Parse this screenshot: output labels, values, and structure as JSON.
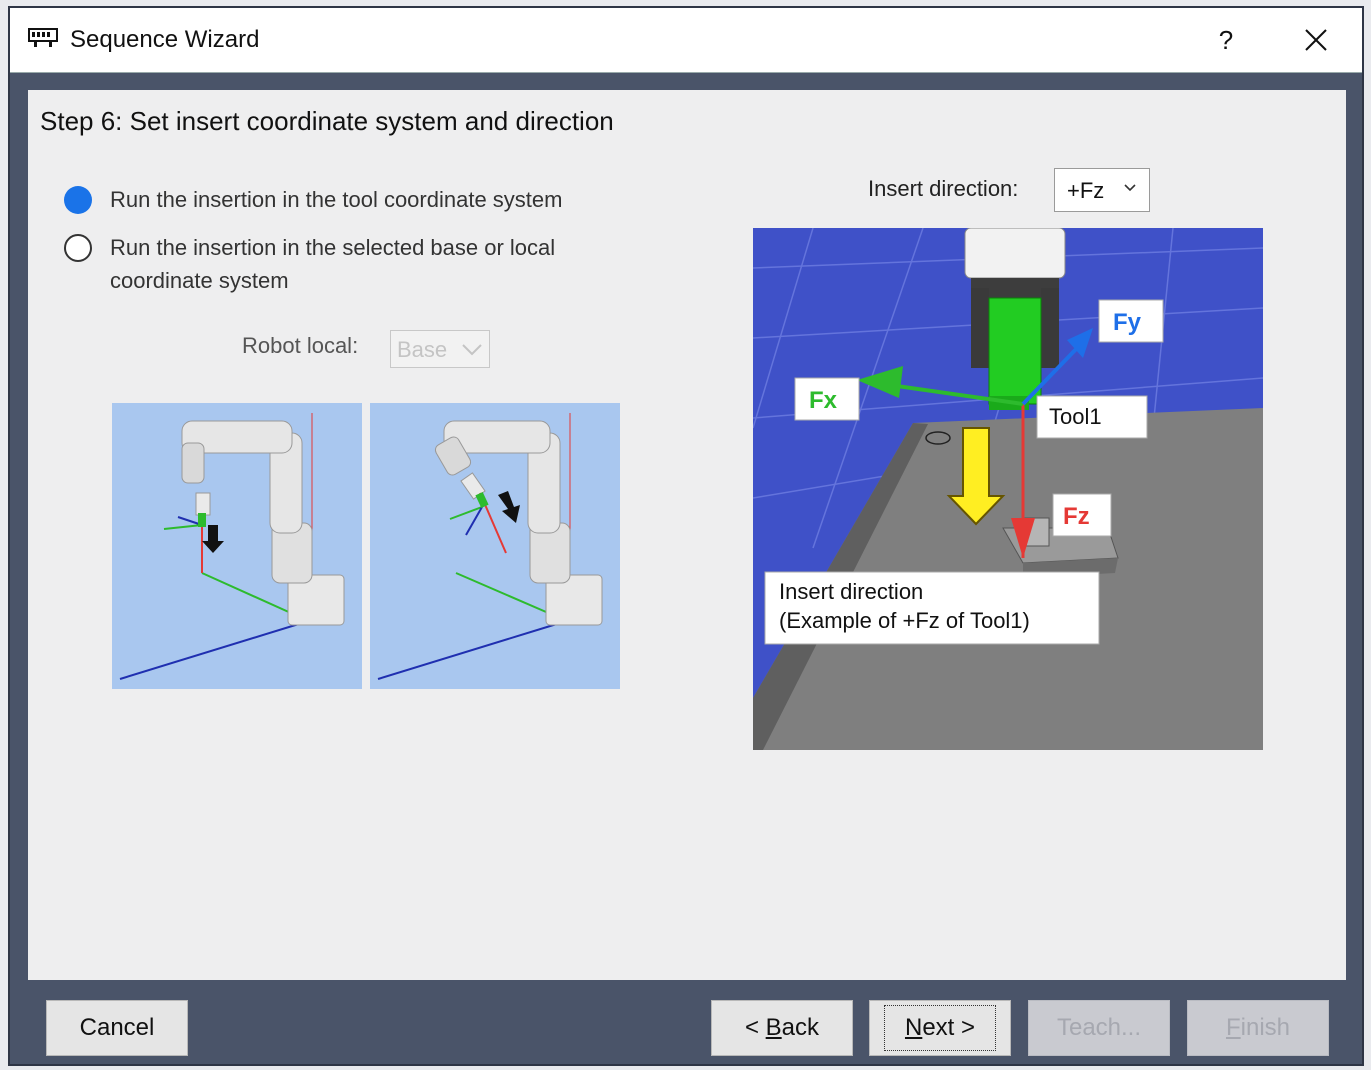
{
  "window": {
    "title": "Sequence Wizard",
    "help": "?",
    "icon": "robot-wizard-icon"
  },
  "step": {
    "title": "Step 6: Set insert coordinate system and direction"
  },
  "options": [
    {
      "label": "Run the insertion in the tool coordinate system",
      "selected": true
    },
    {
      "label_line1": "Run the insertion in the selected base or local",
      "label_line2": "coordinate system",
      "selected": false
    }
  ],
  "robot_local": {
    "label": "Robot local:",
    "value": "Base"
  },
  "insert_direction": {
    "label": "Insert direction:",
    "value": "+Fz"
  },
  "diagram": {
    "fy": "Fy",
    "fx": "Fx",
    "fz": "Fz",
    "tool": "Tool1",
    "caption_line1": "Insert direction",
    "caption_line2": "(Example of +Fz of Tool1)"
  },
  "buttons": {
    "cancel": "Cancel",
    "back_prefix": "< ",
    "back_key": "B",
    "back_rest": "ack",
    "next_key": "N",
    "next_rest": "ext >",
    "teach": "Teach...",
    "finish_key": "F",
    "finish_rest": "inish"
  },
  "colors": {
    "accent": "#1a73e8",
    "frame": "#4a5469",
    "scene_floor": "#3f51b5",
    "thumb_bg": "#a9c7ef"
  }
}
